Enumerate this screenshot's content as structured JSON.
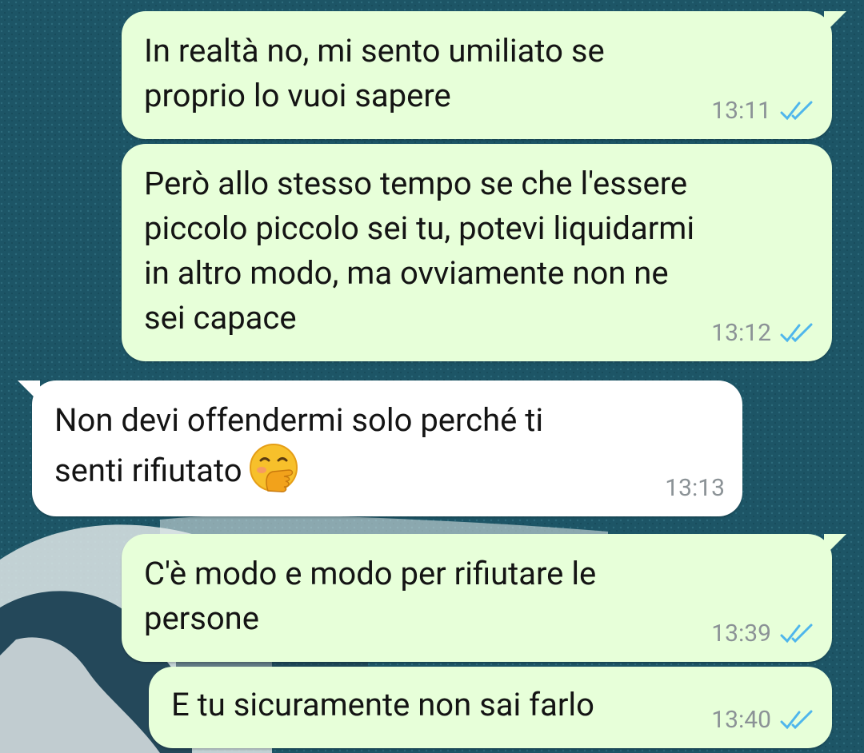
{
  "messages": [
    {
      "direction": "outgoing",
      "text": "In realtà no, mi sento umiliato se\nproprio lo vuoi sapere",
      "time": "13:11",
      "status": "read",
      "status_icon": "double-check-icon"
    },
    {
      "direction": "outgoing",
      "text": "Però allo stesso tempo se che l'essere\npiccolo piccolo sei tu, potevi liquidarmi\nin altro modo, ma ovviamente non ne\nsei capace",
      "time": "13:12",
      "status": "read",
      "status_icon": "double-check-icon"
    },
    {
      "direction": "incoming",
      "text": "Non devi offendermi solo perché ti\nsenti rifiutato",
      "emoji": "face-with-hand-over-mouth",
      "time": "13:13"
    },
    {
      "direction": "outgoing",
      "text": "C'è modo e modo per rifiutare le\npersone",
      "time": "13:39",
      "status": "read",
      "status_icon": "double-check-icon"
    },
    {
      "direction": "outgoing",
      "text": "E tu sicuramente non sai farlo",
      "time": "13:40",
      "status": "read",
      "status_icon": "double-check-icon"
    }
  ],
  "colors": {
    "outgoing_bubble": "#e7ffd9",
    "incoming_bubble": "#ffffff",
    "read_ticks": "#4fb6ec",
    "timestamp": "#8b9296",
    "wallpaper": "#1d5566"
  }
}
